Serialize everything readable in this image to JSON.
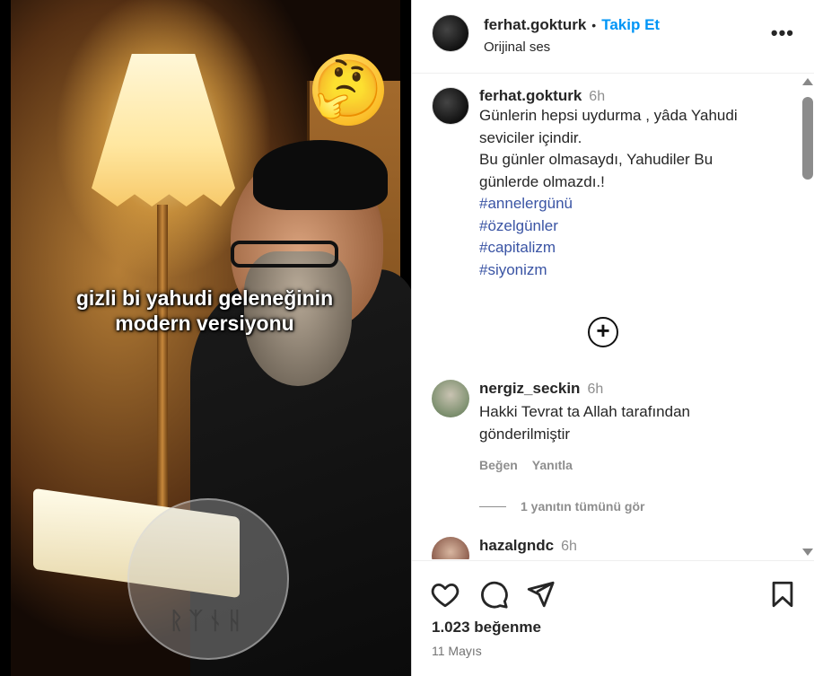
{
  "media": {
    "overlay_line1": "gizli bi yahudi geleneğinin",
    "overlay_line2": "modern versiyonu",
    "emoji_icon": "thinking-face-emoji",
    "watermark_runes": "ᚱᛉᚾᚺ"
  },
  "header": {
    "username": "ferhat.gokturk",
    "separator": "•",
    "follow_label": "Takip Et",
    "audio_label": "Orijinal ses",
    "more_icon": "more-horizontal-icon"
  },
  "caption": {
    "username": "ferhat.gokturk",
    "time": "6h",
    "lines": [
      "Günlerin hepsi uydurma , yâda Yahudi",
      "seviciler içindir.",
      "Bu günler olmasaydı,  Yahudiler Bu",
      "günlerde olmazdı.!"
    ],
    "hashtags": [
      "#annelergünü",
      "#özelgünler",
      "#capitalizm",
      "#siyonizm"
    ]
  },
  "comments": [
    {
      "username": "nergiz_seckin",
      "time": "6h",
      "lines": [
        "Hakki Tevrat ta Allah tarafından",
        "gönderilmiştir"
      ],
      "like_label": "Beğen",
      "reply_label": "Yanıtla",
      "view_replies": "1 yanıtın tümünü gör"
    },
    {
      "username": "hazalgndc",
      "time": "6h"
    }
  ],
  "footer": {
    "likes": "1.023 beğenme",
    "date": "11 Mayıs"
  }
}
